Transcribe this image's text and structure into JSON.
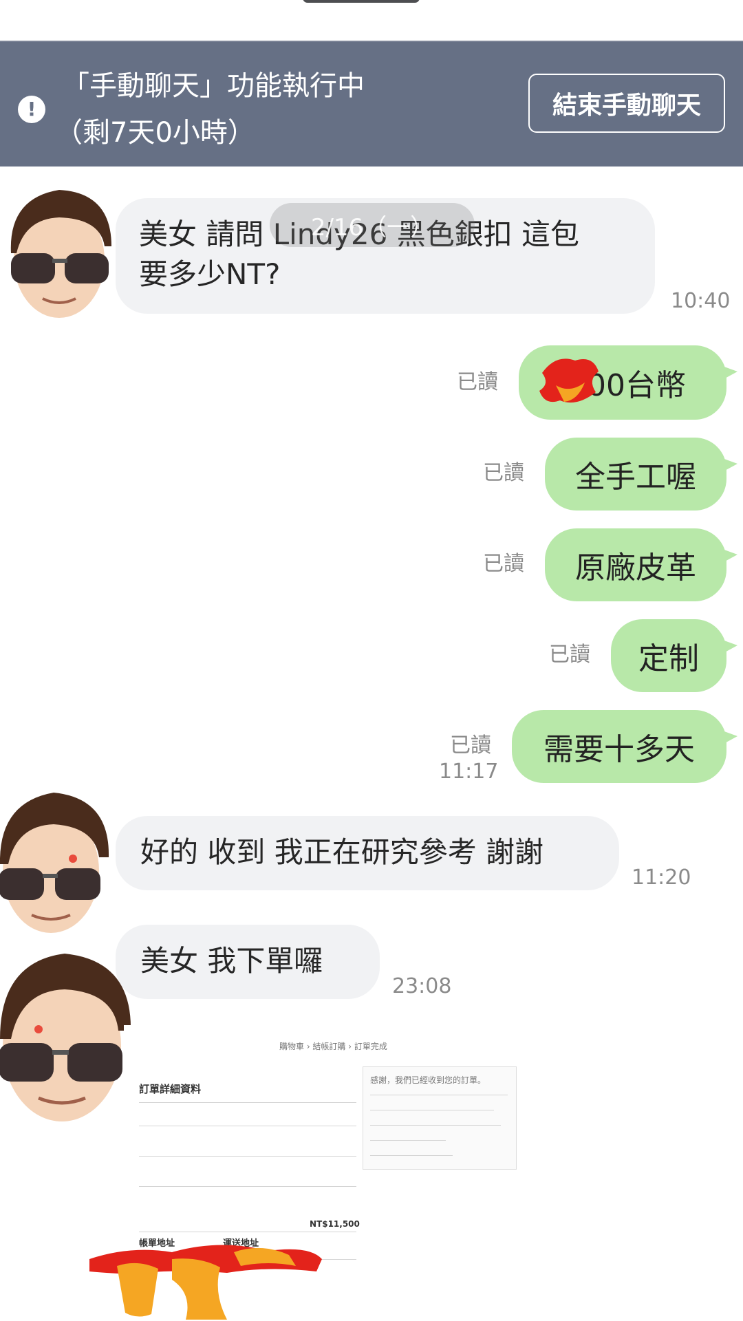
{
  "banner": {
    "line1": "「手動聊天」功能執行中",
    "line2": "（剩7天0小時）",
    "end_button_label": "結束手動聊天",
    "icon": "exclamation-icon"
  },
  "date_separator": "2/16（一）",
  "messages": {
    "m1": {
      "text_line1": "美女 請問 Lindy26 黑色銀扣 這包",
      "text_line2": "要多少NT?",
      "time": "10:40"
    },
    "o1": {
      "text": "00台幣",
      "read": "已讀"
    },
    "o2": {
      "text": "全手工喔",
      "read": "已讀"
    },
    "o3": {
      "text": "原廠皮革",
      "read": "已讀"
    },
    "o4": {
      "text": "定制",
      "read": "已讀"
    },
    "o5": {
      "text": "需要十多天",
      "read": "已讀",
      "time": "11:17"
    },
    "m2": {
      "text": "好的 收到 我正在研究參考 謝謝",
      "time": "11:20"
    },
    "m3": {
      "text": "美女  我下單囉",
      "time": "23:08"
    }
  },
  "order_doc": {
    "breadcrumb": "購物車 › 結帳訂購 › 訂單完成",
    "heading": "訂單詳細資料",
    "note": "感謝，我們已經收到您的訂單。",
    "billing": "帳單地址",
    "shipping": "運送地址",
    "total": "NT$11,500"
  },
  "colors": {
    "banner_bg": "#667085",
    "incoming_bubble": "#f1f2f4",
    "outgoing_bubble": "#b8e8a9"
  }
}
